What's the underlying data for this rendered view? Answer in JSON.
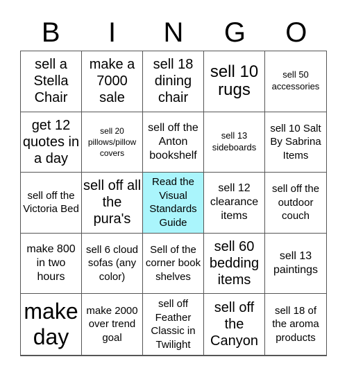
{
  "header": {
    "letters": [
      "B",
      "I",
      "N",
      "G",
      "O"
    ]
  },
  "board": {
    "free_cell_color": "#aaf5fc",
    "cells": [
      "sell a Stella Chair",
      "make a 7000 sale",
      "sell 18 dining chair",
      "sell 10 rugs",
      "sell 50 accessories",
      "get 12 quotes in a day",
      "sell 20 pillows/pillow covers",
      "sell off the Anton bookshelf",
      "sell 13 sideboards",
      "sell 10 Salt By Sabrina Items",
      "sell off the Victoria Bed",
      "sell off all the pura's",
      "Read the Visual Standards Guide",
      "sell 12 clearance items",
      "sell off the outdoor couch",
      "make 800 in two hours",
      "sell 6 cloud sofas (any color)",
      "Sell of the corner book shelves",
      "sell 60 bedding items",
      "sell 13 paintings",
      "make day",
      "make 2000 over trend goal",
      "sell off Feather Classic in Twilight",
      "sell off the Canyon",
      "sell 18 of the aroma products"
    ]
  }
}
